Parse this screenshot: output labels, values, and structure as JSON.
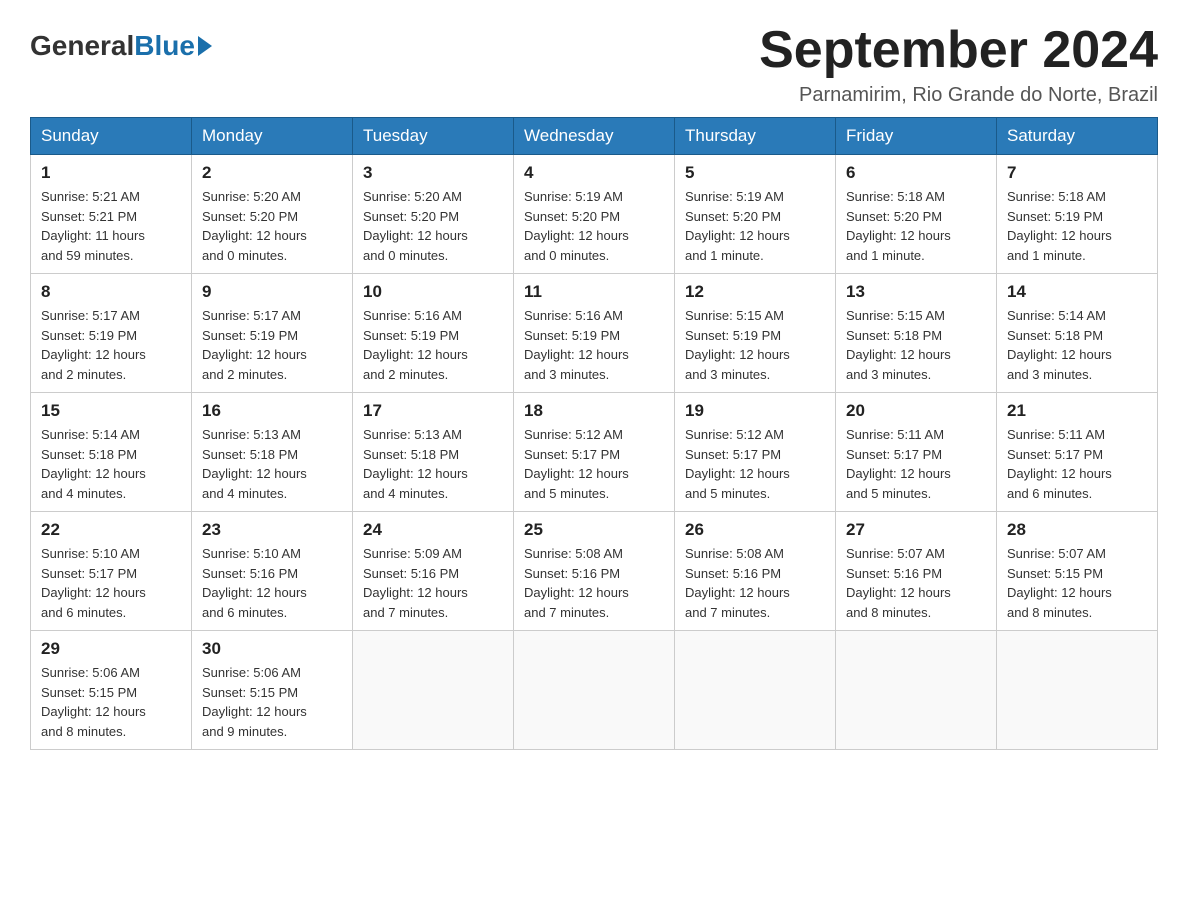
{
  "header": {
    "logo_general": "General",
    "logo_blue": "Blue",
    "title": "September 2024",
    "subtitle": "Parnamirim, Rio Grande do Norte, Brazil"
  },
  "days_of_week": [
    "Sunday",
    "Monday",
    "Tuesday",
    "Wednesday",
    "Thursday",
    "Friday",
    "Saturday"
  ],
  "weeks": [
    [
      {
        "day": "1",
        "sunrise": "5:21 AM",
        "sunset": "5:21 PM",
        "daylight": "11 hours and 59 minutes."
      },
      {
        "day": "2",
        "sunrise": "5:20 AM",
        "sunset": "5:20 PM",
        "daylight": "12 hours and 0 minutes."
      },
      {
        "day": "3",
        "sunrise": "5:20 AM",
        "sunset": "5:20 PM",
        "daylight": "12 hours and 0 minutes."
      },
      {
        "day": "4",
        "sunrise": "5:19 AM",
        "sunset": "5:20 PM",
        "daylight": "12 hours and 0 minutes."
      },
      {
        "day": "5",
        "sunrise": "5:19 AM",
        "sunset": "5:20 PM",
        "daylight": "12 hours and 1 minute."
      },
      {
        "day": "6",
        "sunrise": "5:18 AM",
        "sunset": "5:20 PM",
        "daylight": "12 hours and 1 minute."
      },
      {
        "day": "7",
        "sunrise": "5:18 AM",
        "sunset": "5:19 PM",
        "daylight": "12 hours and 1 minute."
      }
    ],
    [
      {
        "day": "8",
        "sunrise": "5:17 AM",
        "sunset": "5:19 PM",
        "daylight": "12 hours and 2 minutes."
      },
      {
        "day": "9",
        "sunrise": "5:17 AM",
        "sunset": "5:19 PM",
        "daylight": "12 hours and 2 minutes."
      },
      {
        "day": "10",
        "sunrise": "5:16 AM",
        "sunset": "5:19 PM",
        "daylight": "12 hours and 2 minutes."
      },
      {
        "day": "11",
        "sunrise": "5:16 AM",
        "sunset": "5:19 PM",
        "daylight": "12 hours and 3 minutes."
      },
      {
        "day": "12",
        "sunrise": "5:15 AM",
        "sunset": "5:19 PM",
        "daylight": "12 hours and 3 minutes."
      },
      {
        "day": "13",
        "sunrise": "5:15 AM",
        "sunset": "5:18 PM",
        "daylight": "12 hours and 3 minutes."
      },
      {
        "day": "14",
        "sunrise": "5:14 AM",
        "sunset": "5:18 PM",
        "daylight": "12 hours and 3 minutes."
      }
    ],
    [
      {
        "day": "15",
        "sunrise": "5:14 AM",
        "sunset": "5:18 PM",
        "daylight": "12 hours and 4 minutes."
      },
      {
        "day": "16",
        "sunrise": "5:13 AM",
        "sunset": "5:18 PM",
        "daylight": "12 hours and 4 minutes."
      },
      {
        "day": "17",
        "sunrise": "5:13 AM",
        "sunset": "5:18 PM",
        "daylight": "12 hours and 4 minutes."
      },
      {
        "day": "18",
        "sunrise": "5:12 AM",
        "sunset": "5:17 PM",
        "daylight": "12 hours and 5 minutes."
      },
      {
        "day": "19",
        "sunrise": "5:12 AM",
        "sunset": "5:17 PM",
        "daylight": "12 hours and 5 minutes."
      },
      {
        "day": "20",
        "sunrise": "5:11 AM",
        "sunset": "5:17 PM",
        "daylight": "12 hours and 5 minutes."
      },
      {
        "day": "21",
        "sunrise": "5:11 AM",
        "sunset": "5:17 PM",
        "daylight": "12 hours and 6 minutes."
      }
    ],
    [
      {
        "day": "22",
        "sunrise": "5:10 AM",
        "sunset": "5:17 PM",
        "daylight": "12 hours and 6 minutes."
      },
      {
        "day": "23",
        "sunrise": "5:10 AM",
        "sunset": "5:16 PM",
        "daylight": "12 hours and 6 minutes."
      },
      {
        "day": "24",
        "sunrise": "5:09 AM",
        "sunset": "5:16 PM",
        "daylight": "12 hours and 7 minutes."
      },
      {
        "day": "25",
        "sunrise": "5:08 AM",
        "sunset": "5:16 PM",
        "daylight": "12 hours and 7 minutes."
      },
      {
        "day": "26",
        "sunrise": "5:08 AM",
        "sunset": "5:16 PM",
        "daylight": "12 hours and 7 minutes."
      },
      {
        "day": "27",
        "sunrise": "5:07 AM",
        "sunset": "5:16 PM",
        "daylight": "12 hours and 8 minutes."
      },
      {
        "day": "28",
        "sunrise": "5:07 AM",
        "sunset": "5:15 PM",
        "daylight": "12 hours and 8 minutes."
      }
    ],
    [
      {
        "day": "29",
        "sunrise": "5:06 AM",
        "sunset": "5:15 PM",
        "daylight": "12 hours and 8 minutes."
      },
      {
        "day": "30",
        "sunrise": "5:06 AM",
        "sunset": "5:15 PM",
        "daylight": "12 hours and 9 minutes."
      },
      null,
      null,
      null,
      null,
      null
    ]
  ],
  "labels": {
    "sunrise_prefix": "Sunrise: ",
    "sunset_prefix": "Sunset: ",
    "daylight_prefix": "Daylight: "
  }
}
